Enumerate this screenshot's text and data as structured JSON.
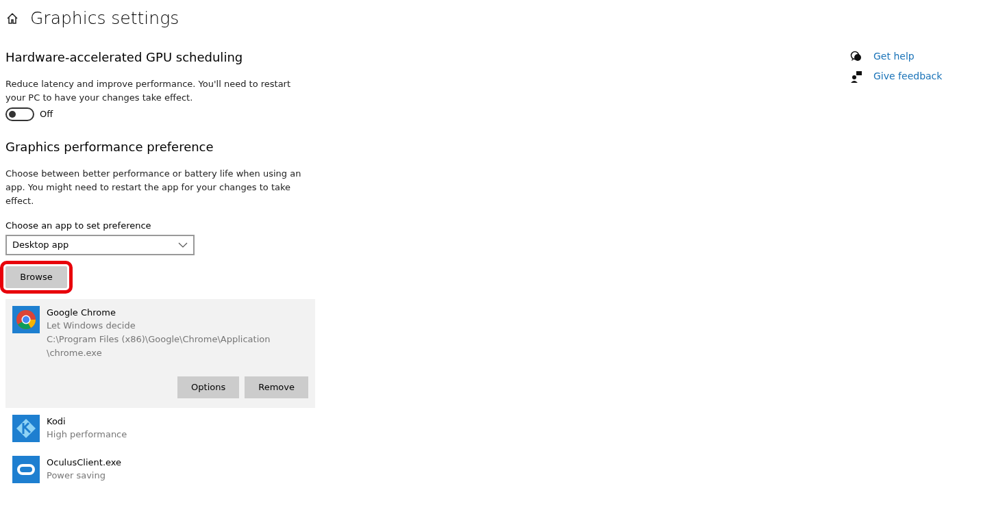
{
  "header": {
    "title": "Graphics settings"
  },
  "gpu_scheduling": {
    "heading": "Hardware-accelerated GPU scheduling",
    "description": "Reduce latency and improve performance. You'll need to restart your PC to have your changes take effect.",
    "toggle": {
      "on": false,
      "label": "Off"
    }
  },
  "preference": {
    "heading": "Graphics performance preference",
    "description": "Choose between better performance or battery life when using an app. You might need to restart the app for your changes to take effect.",
    "dropdown_label": "Choose an app to set preference",
    "dropdown": {
      "value": "Desktop app"
    },
    "browse_button": {
      "label": "Browse",
      "highlighted": true
    }
  },
  "apps": [
    {
      "kind": "chrome",
      "name": "Google Chrome",
      "setting": "Let Windows decide",
      "path": "C:\\Program Files (x86)\\Google\\Chrome\\Application \\chrome.exe",
      "selected": true,
      "buttons": [
        "Options",
        "Remove"
      ]
    },
    {
      "kind": "kodi",
      "name": "Kodi",
      "setting": "High performance",
      "selected": false
    },
    {
      "kind": "oculus",
      "name": "OculusClient.exe",
      "setting": "Power saving",
      "selected": false
    }
  ],
  "side_links": [
    {
      "kind": "help",
      "label": "Get help"
    },
    {
      "kind": "feedback",
      "label": "Give feedback"
    }
  ]
}
